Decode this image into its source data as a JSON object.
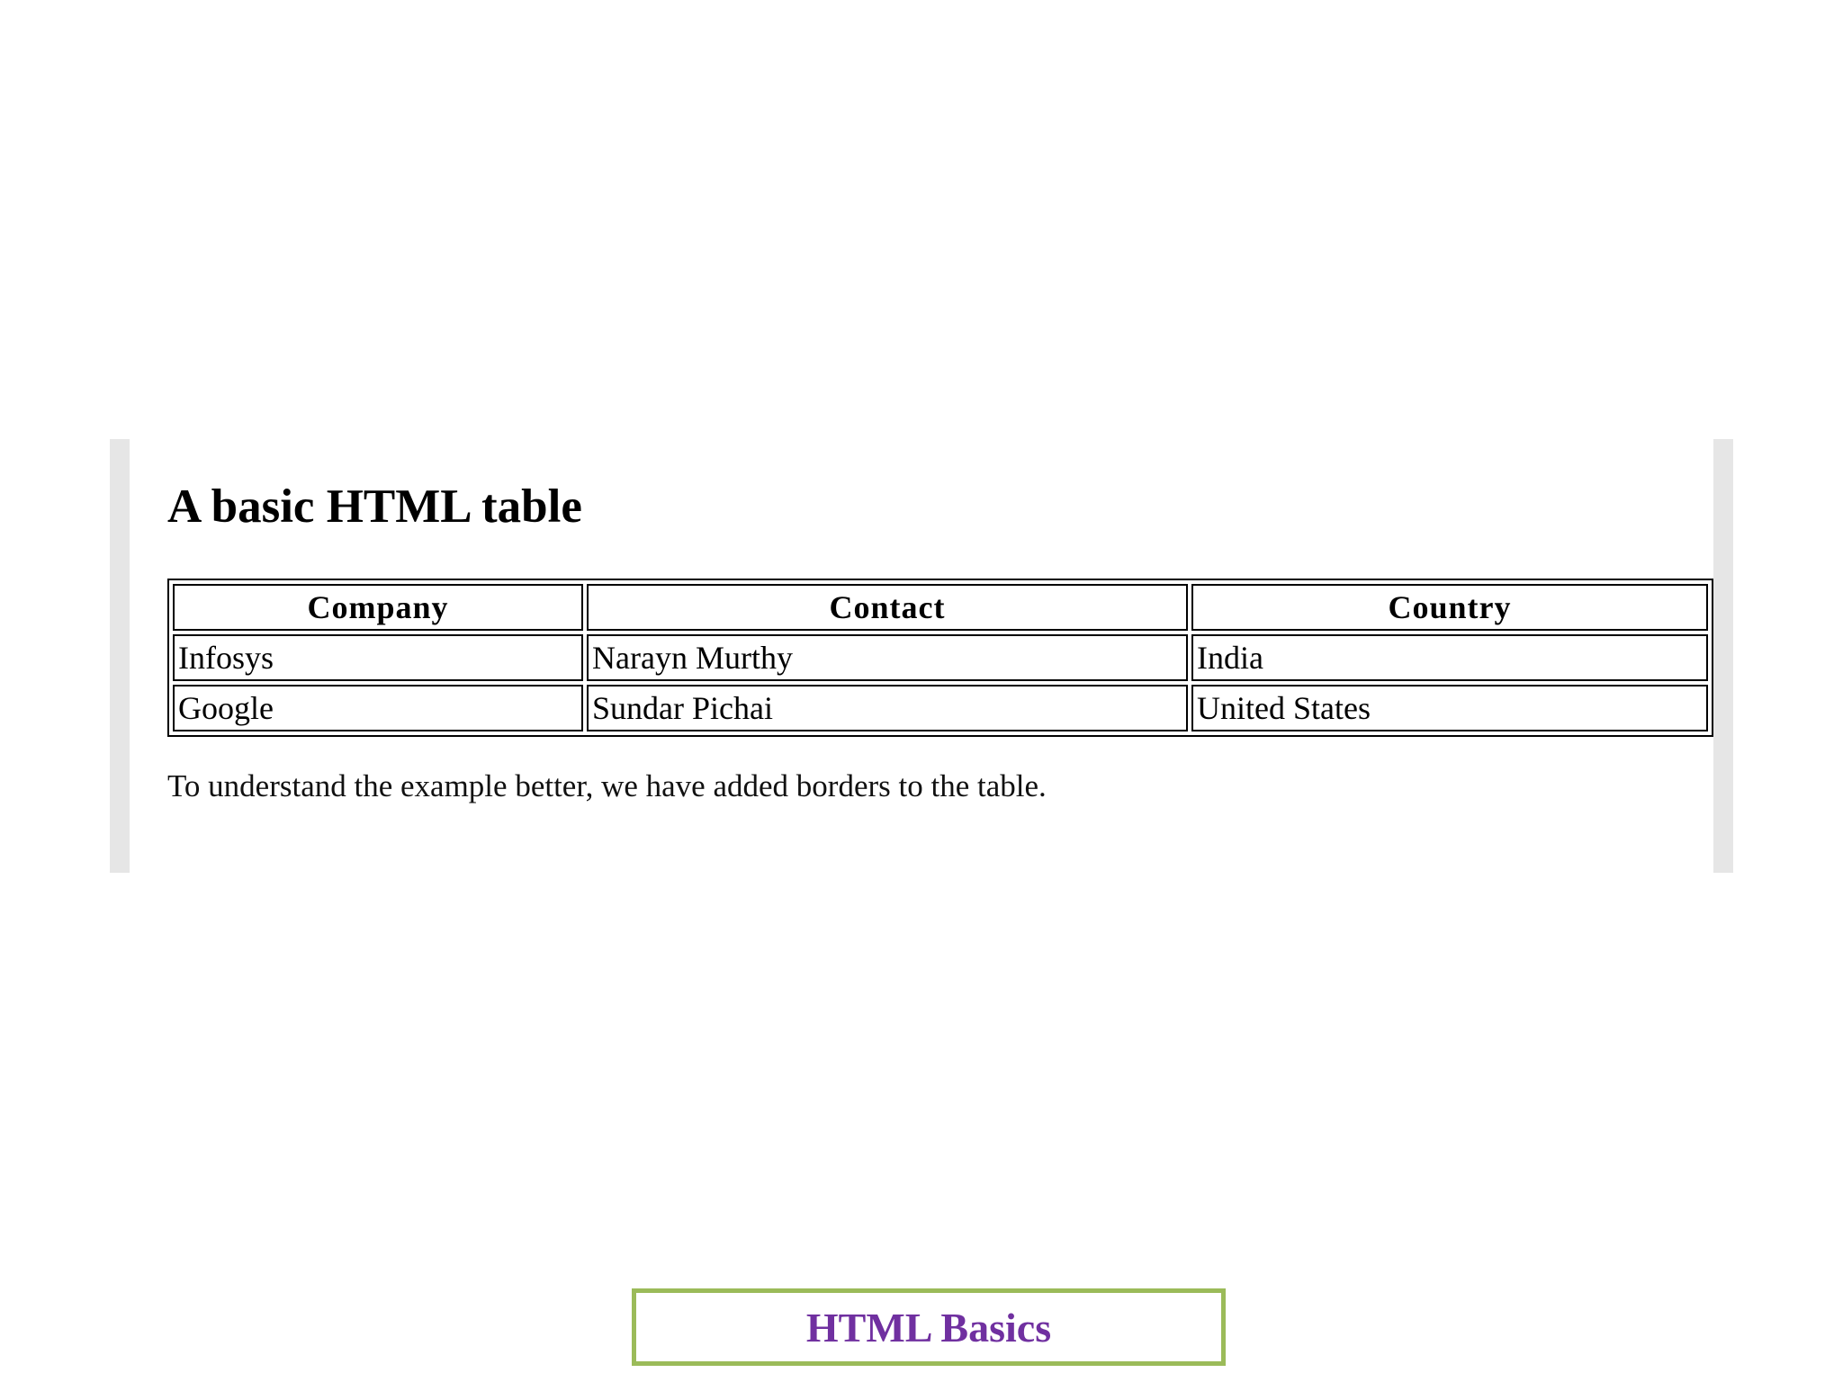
{
  "slide": {
    "footer_title": "HTML Basics",
    "footer_border_color": "#9bbb59",
    "footer_text_color": "#7030a0"
  },
  "example": {
    "heading": "A basic HTML table",
    "table": {
      "headers": [
        "Company",
        "Contact",
        "Country"
      ],
      "rows": [
        [
          "Infosys",
          "Narayn Murthy",
          "India"
        ],
        [
          "Google",
          "Sundar Pichai",
          "United States"
        ]
      ]
    },
    "note": "To understand the example better, we have added borders to the table."
  }
}
